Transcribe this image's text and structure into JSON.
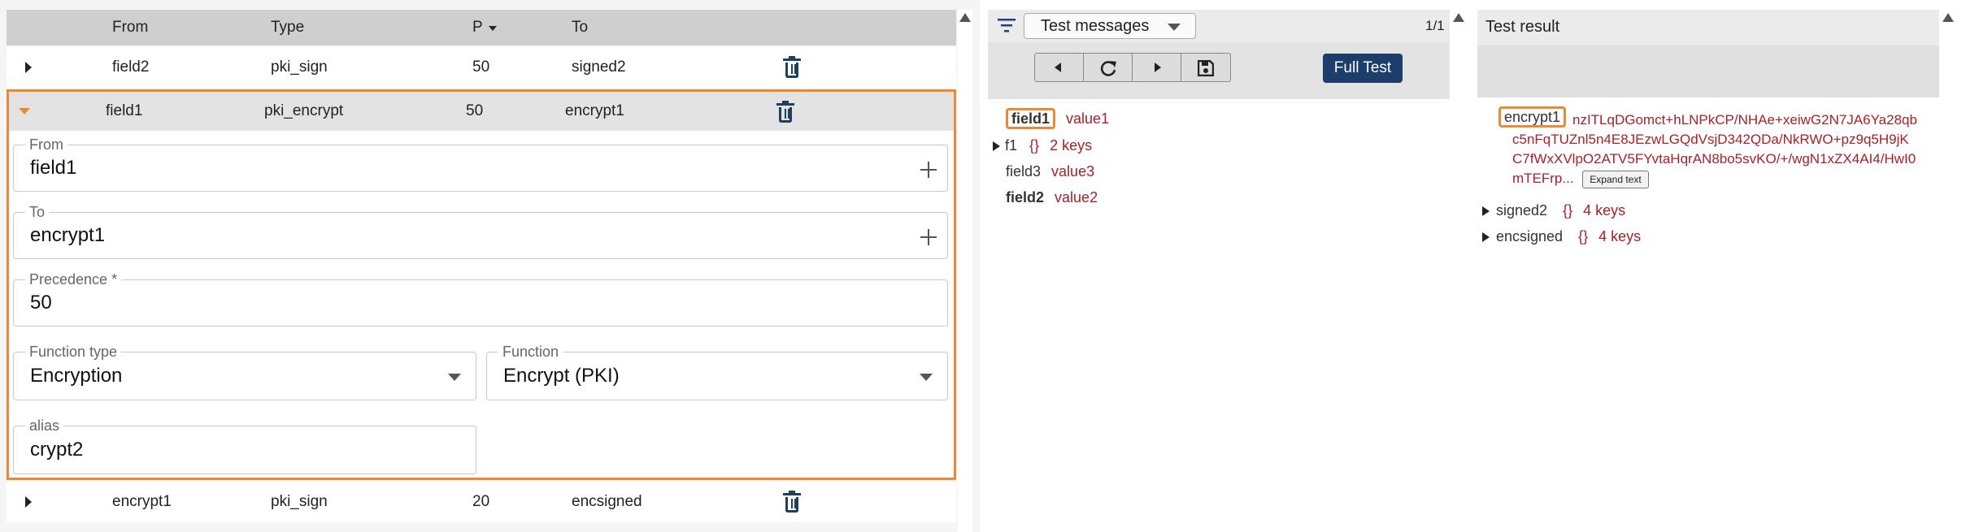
{
  "rules_table": {
    "headers": {
      "from": "From",
      "type": "Type",
      "precedence": "P",
      "to": "To"
    },
    "rows": [
      {
        "from": "field2",
        "type": "pki_sign",
        "precedence": "50",
        "to": "signed2",
        "expanded": false
      },
      {
        "from": "field1",
        "type": "pki_encrypt",
        "precedence": "50",
        "to": "encrypt1",
        "expanded": true
      },
      {
        "from": "encrypt1",
        "type": "pki_sign",
        "precedence": "20",
        "to": "encsigned",
        "expanded": false
      }
    ],
    "editor": {
      "from": {
        "label": "From",
        "value": "field1"
      },
      "to": {
        "label": "To",
        "value": "encrypt1"
      },
      "precedence": {
        "label": "Precedence *",
        "value": "50"
      },
      "function_type": {
        "label": "Function type",
        "value": "Encryption"
      },
      "function": {
        "label": "Function",
        "value": "Encrypt (PKI)"
      },
      "alias": {
        "label": "alias",
        "value": "crypt2"
      }
    }
  },
  "test_messages": {
    "dropdown_label": "Test messages",
    "page_counter": "1/1",
    "full_test_label": "Full Test",
    "items": [
      {
        "key": "field1",
        "value": "value1",
        "highlighted": true
      },
      {
        "key": "f1",
        "braces": "{}",
        "summary": "2 keys",
        "collapsible": true
      },
      {
        "key": "field3",
        "value": "value3"
      },
      {
        "key": "field2",
        "value": "value2",
        "bold": true
      }
    ]
  },
  "test_result": {
    "title": "Test result",
    "encrypt_key": "encrypt1",
    "encrypt_value_lines": [
      "nzITLqDGomct+hLNPkCP/NHAe+xeiwG2N7JA6Ya28qb",
      "c5nFqTUZnl5n4E8JEzwLGQdVsjD342QDa/NkRWO+pz9q5H9jK",
      "C7fWxXVlpO2ATV5FYvtaHqrAN8bo5svKO/+/wgN1xZX4AI4/HwI0",
      "mTEFrp..."
    ],
    "expand_text_label": "Expand text",
    "items": [
      {
        "key": "signed2",
        "braces": "{}",
        "summary": "4 keys"
      },
      {
        "key": "encsigned",
        "braces": "{}",
        "summary": "4 keys"
      }
    ]
  },
  "colors": {
    "accent": "#ee8833",
    "primary_button": "#1d3e6a",
    "value_text": "#a8202a",
    "icon": "#1f3f5f"
  }
}
